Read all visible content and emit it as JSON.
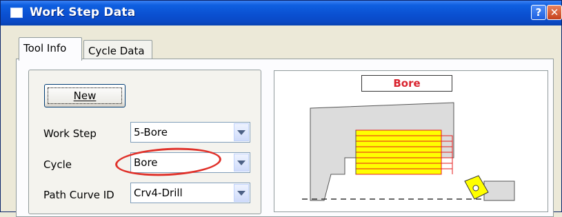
{
  "window": {
    "title": "Work Step Data"
  },
  "tabs": [
    {
      "label": "Tool Info"
    },
    {
      "label": "Cycle Data"
    }
  ],
  "form": {
    "new_button_label": "New",
    "fields": [
      {
        "label": "Work Step",
        "value": "5-Bore"
      },
      {
        "label": "Cycle",
        "value": "Bore"
      },
      {
        "label": "Path Curve ID",
        "value": "Crv4-Drill"
      }
    ]
  },
  "preview": {
    "title": "Bore"
  },
  "icons": {
    "help": "question-icon",
    "close": "close-icon",
    "app": "window-icon"
  },
  "colors": {
    "titlebar": "#0a4fd0",
    "highlight": "#e0312a",
    "bore_fill": "#ffff00",
    "bore_lines": "#e51a1a",
    "stock": "#dcdcdc"
  }
}
